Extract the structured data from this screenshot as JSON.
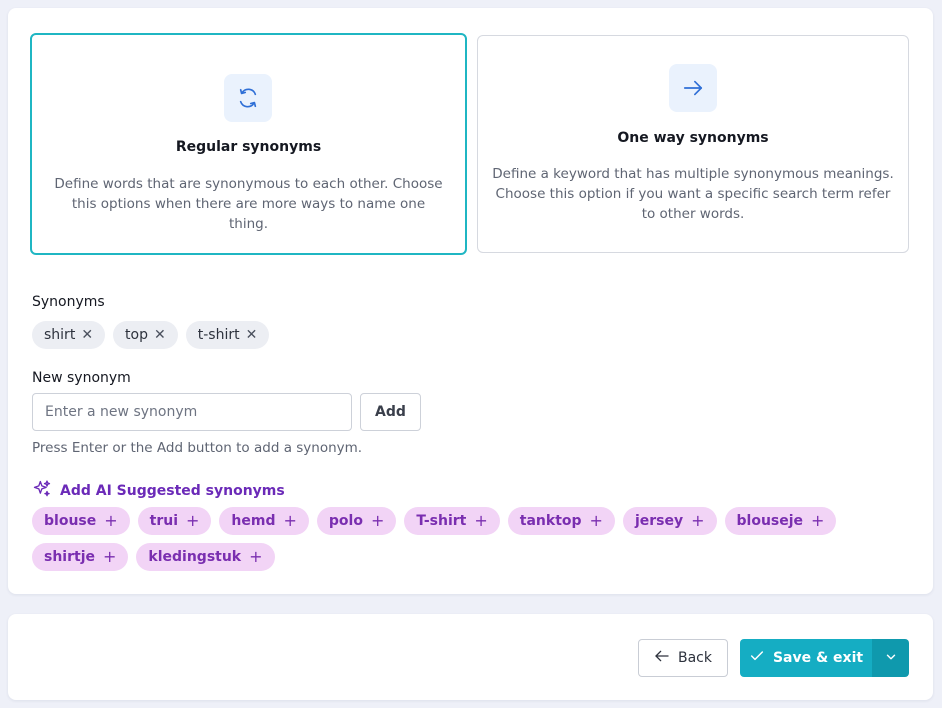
{
  "options": {
    "regular": {
      "icon": "refresh-icon",
      "title": "Regular synonyms",
      "description": "Define words that are synonymous to each other. Choose this options when there are more ways to name one thing.",
      "selected": true
    },
    "oneway": {
      "icon": "arrow-right-icon",
      "title": "One way synonyms",
      "description": "Define a keyword that has multiple synonymous meanings. Choose this option if you want a specific search term refer to other words.",
      "selected": false
    }
  },
  "synonyms": {
    "label": "Synonyms",
    "items": [
      "shirt",
      "top",
      "t-shirt"
    ]
  },
  "new_synonym": {
    "label": "New synonym",
    "value": "",
    "placeholder": "Enter a new synonym",
    "add_label": "Add",
    "help": "Press Enter or the Add button to add a synonym."
  },
  "ai": {
    "link_label": "Add AI Suggested synonyms",
    "suggestions": [
      "blouse",
      "trui",
      "hemd",
      "polo",
      "T-shirt",
      "tanktop",
      "jersey",
      "blouseje",
      "shirtje",
      "kledingstuk"
    ]
  },
  "footer": {
    "back_label": "Back",
    "save_label": "Save & exit"
  },
  "colors": {
    "accent": "#15adc3",
    "accent_dark": "#0f99ad",
    "selected_border": "#1fb6c3",
    "ai_text": "#7a2eb0",
    "ai_chip_bg": "#f2d4f6",
    "icon_blue": "#2f6fd6"
  }
}
